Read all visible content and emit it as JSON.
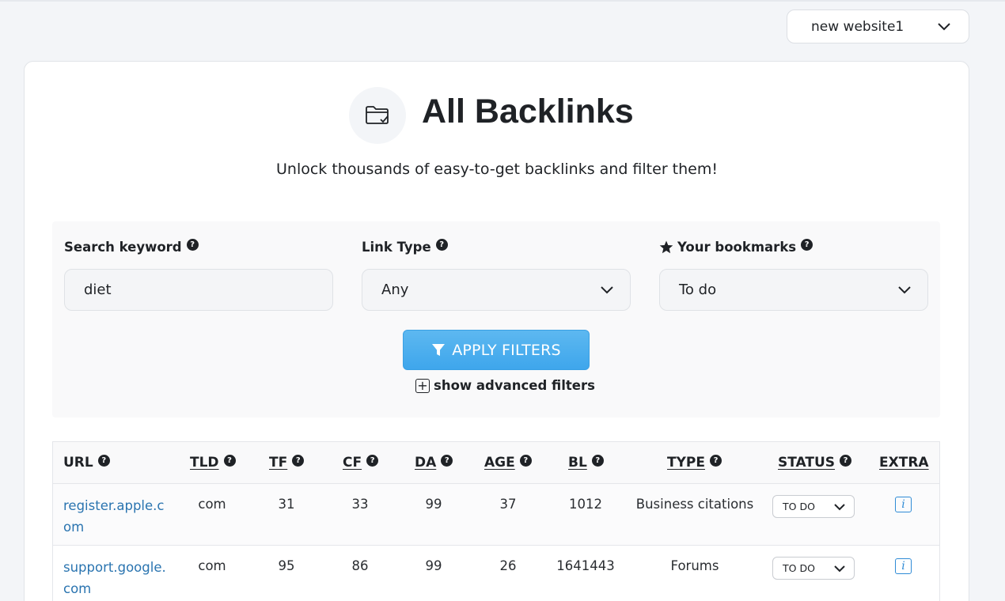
{
  "website_select": {
    "value": "new website1"
  },
  "hero": {
    "icon": "folder-check-icon",
    "title": "All Backlinks",
    "subtitle": "Unlock thousands of easy-to-get backlinks and filter them!"
  },
  "filters": {
    "keyword": {
      "label": "Search keyword",
      "value": "diet"
    },
    "link_type": {
      "label": "Link Type",
      "value": "Any"
    },
    "bookmarks": {
      "label": "Your bookmarks",
      "value": "To do",
      "icon": "star-icon"
    },
    "apply_label": "APPLY FILTERS",
    "advanced_label": "show advanced filters",
    "help_glyph": "?"
  },
  "table": {
    "headers": {
      "url": "URL",
      "tld": "TLD",
      "tf": "TF",
      "cf": "CF",
      "da": "DA",
      "age": "AGE",
      "bl": "BL",
      "type": "TYPE",
      "status": "STATUS",
      "extra": "EXTRA"
    },
    "rows": [
      {
        "url": "register.apple.com",
        "tld": "com",
        "tf": "31",
        "cf": "33",
        "da": "99",
        "age": "37",
        "bl": "1012",
        "type": "Business citations",
        "status": "TO DO",
        "extra": "i"
      },
      {
        "url": "support.google.com",
        "tld": "com",
        "tf": "95",
        "cf": "86",
        "da": "99",
        "age": "26",
        "bl": "1641443",
        "type": "Forums",
        "status": "TO DO",
        "extra": "i"
      }
    ]
  },
  "colors": {
    "accent": "#45aaee",
    "link": "#2a74b0",
    "info": "#2f8bd6"
  }
}
